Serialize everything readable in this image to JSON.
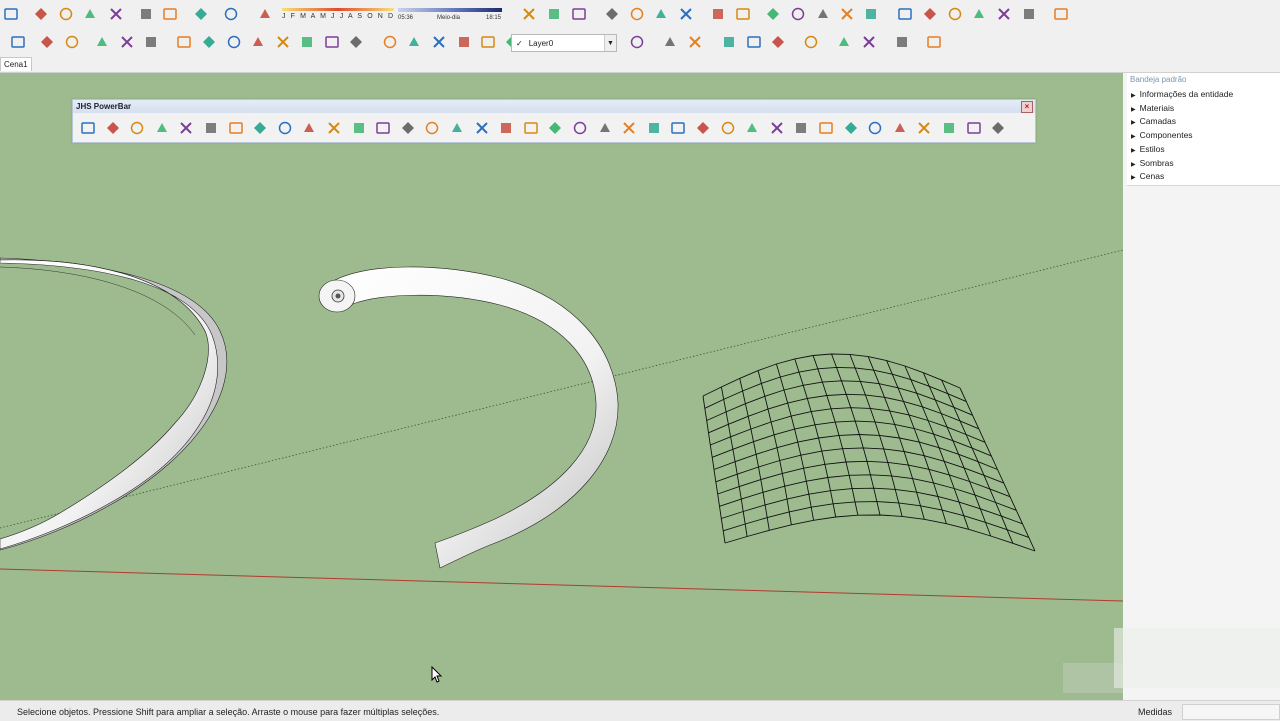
{
  "toolbar": {
    "row1_icons": [
      "new-file-icon",
      "cut-icon",
      "copy-icon",
      "paste-icon",
      "erase-icon",
      "undo-icon",
      "redo-icon",
      "print-icon",
      "model-info-icon",
      "eraser-icon",
      "iso-view-icon",
      "top-view-icon",
      "front-view-icon",
      "right-view-icon",
      "back-view-icon",
      "left-view-icon",
      "xray-style-icon",
      "wireframe-style-icon",
      "hidden-line-style-icon",
      "shaded-style-icon",
      "textured-style-icon",
      "monochrome-style-icon",
      "warehouse-icon",
      "share-model-icon",
      "house-icon",
      "section-icon",
      "component-icon",
      "extension-icon",
      "shield-icon",
      "cloud-icon",
      "tree-icon"
    ],
    "row2_icons": [
      "select-icon",
      "component-browser-icon",
      "line-icon",
      "rectangle-icon",
      "circle-icon",
      "arc-icon",
      "polygon-icon",
      "pushpull-icon",
      "followme-icon",
      "offset-icon",
      "move-icon",
      "rotate-icon",
      "scale-icon",
      "tape-icon",
      "dimension-icon",
      "protractor-icon",
      "text-icon",
      "axes-icon",
      "section-plane-icon",
      "walk-icon",
      "orbit-icon",
      "pan-icon",
      "zoom-icon",
      "zoom-window-icon",
      "zoom-extents-icon",
      "layer-manager-icon",
      "paint-icon",
      "sandbox-icon",
      "ruby-icon",
      "leaf-icon",
      "sphere-icon"
    ],
    "sun_months": "J F M A M J J A S O N D",
    "sun_time_start": "05:36",
    "sun_time_mid": "Meio-dia",
    "sun_time_end": "18:15",
    "layer_value": "Layer0",
    "layer_check": "✓"
  },
  "tabs": {
    "scene": "Cena1"
  },
  "powerbar": {
    "title": "JHS PowerBar",
    "close": "×",
    "icons": [
      "blue-hex-icon",
      "blue-diamond-icon",
      "yellow-diamond-icon",
      "green-diamond-icon",
      "red-diamond-icon",
      "white-diamond-icon",
      "orange-spiral-icon",
      "red-square-icon",
      "grid-icon",
      "frame-icon",
      "hand-icon",
      "curve-tool-icon",
      "arc-tool-icon",
      "points-icon",
      "red-cross-icon",
      "green-cross-icon",
      "blue-x-icon",
      "cone-icon",
      "pyramid-icon",
      "triangle-icon",
      "orange-arc-icon",
      "orange-x-icon",
      "ring-icon",
      "compass-icon",
      "box-icon",
      "red-hook-icon",
      "cube-stack-icon",
      "move-cube-icon",
      "copy-cube-icon",
      "explode-icon",
      "red-target-icon",
      "sun-burst-icon",
      "frame2-icon",
      "orange-grid-icon",
      "orange-grid2-icon",
      "red-x2-icon",
      "curve2-icon",
      "panel-icon"
    ]
  },
  "tray": {
    "title": "Bandeja padrão",
    "items": [
      "Informações da entidade",
      "Materiais",
      "Camadas",
      "Componentes",
      "Estilos",
      "Sombras",
      "Cenas"
    ]
  },
  "status": {
    "text": "Selecione objetos. Pressione Shift para ampliar a seleção. Arraste o mouse para fazer múltiplas seleções.",
    "measure_label": "Medidas",
    "measure_value": ""
  },
  "colors": {
    "viewport_bg": "#9dbb8e",
    "red_axis": "#b03a2e",
    "green_axis": "#2e6b2e",
    "tube": "#f6f6f6"
  }
}
